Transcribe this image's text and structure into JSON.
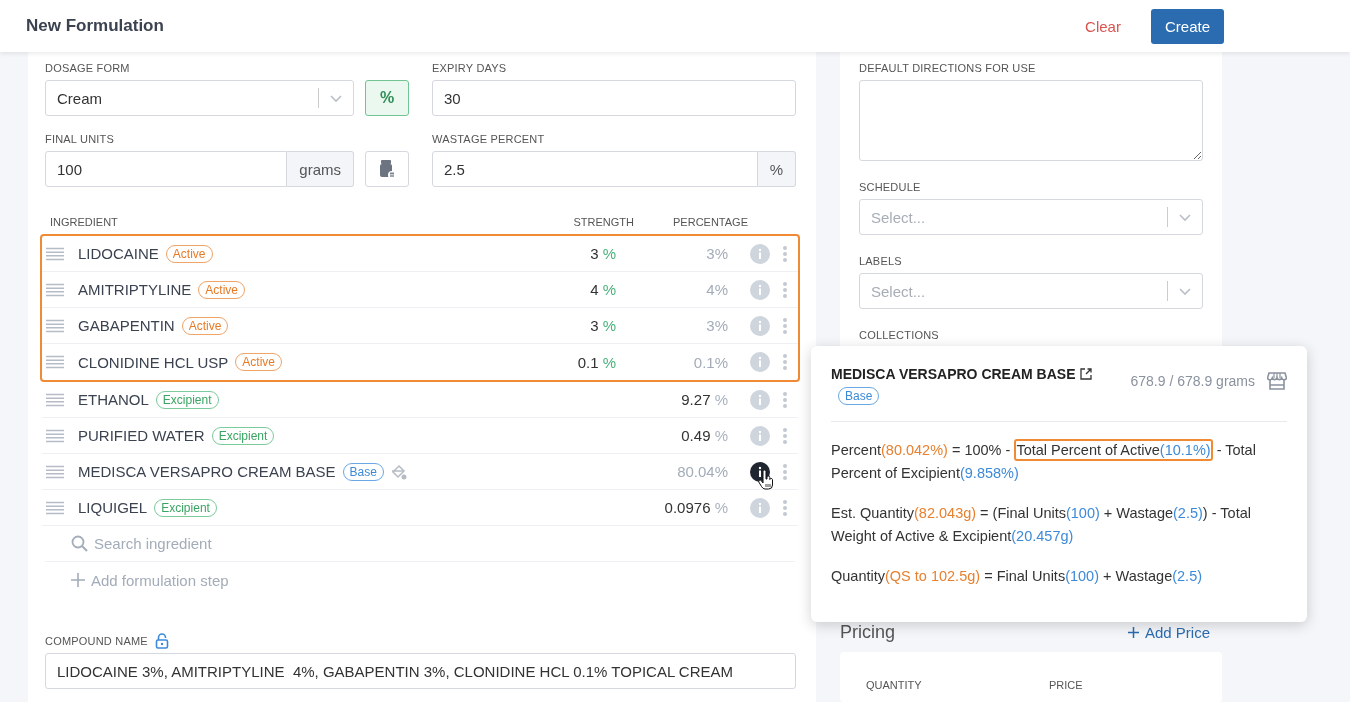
{
  "header": {
    "title": "New Formulation",
    "actions": [
      {
        "label": "Clear",
        "kind": "text"
      },
      {
        "label": "Create",
        "kind": "primary"
      }
    ]
  },
  "form": {
    "dosage_form": {
      "label": "DOSAGE FORM",
      "value": "Cream",
      "toggle": {
        "label": "%",
        "on": true
      }
    },
    "expiry_days": {
      "label": "EXPIRY DAYS",
      "value": "30"
    },
    "final_units": {
      "label": "FINAL UNITS",
      "value": "100",
      "unit": "grams"
    },
    "wastage_percent": {
      "label": "WASTAGE PERCENT",
      "value": "2.5",
      "unit": "%"
    }
  },
  "ingredients": {
    "columns": [
      "INGREDIENT",
      "STRENGTH",
      "PERCENTAGE"
    ],
    "groups": [
      {
        "highlighted": true,
        "rows": [
          {
            "name": "LIDOCAINE",
            "kind": "active",
            "badge": "Active",
            "strength": {
              "value": "3",
              "unit": "%"
            },
            "percentage": "3%",
            "info_hovered": false
          },
          {
            "name": "AMITRIPTYLINE",
            "kind": "active",
            "badge": "Active",
            "strength": {
              "value": "4",
              "unit": "%"
            },
            "percentage": "4%",
            "info_hovered": false
          },
          {
            "name": "GABAPENTIN",
            "kind": "active",
            "badge": "Active",
            "strength": {
              "value": "3",
              "unit": "%"
            },
            "percentage": "3%",
            "info_hovered": false
          },
          {
            "name": "CLONIDINE HCL USP",
            "kind": "active",
            "badge": "Active",
            "strength": {
              "value": "0.1",
              "unit": "%"
            },
            "percentage": "0.1%",
            "info_hovered": false
          }
        ]
      },
      {
        "highlighted": false,
        "rows": [
          {
            "name": "ETHANOL",
            "kind": "excipient",
            "badge": "Excipient",
            "percentage": "9.27",
            "percentage_unit": "%",
            "info_hovered": false
          },
          {
            "name": "PURIFIED WATER",
            "kind": "excipient",
            "badge": "Excipient",
            "percentage": "0.49",
            "percentage_unit": "%",
            "info_hovered": false
          },
          {
            "name": "MEDISCA VERSAPRO CREAM BASE",
            "kind": "base",
            "badge": "Base",
            "qs_icon": true,
            "percentage": "80.04%",
            "info_hovered": true
          },
          {
            "name": "LIQUIGEL",
            "kind": "excipient",
            "badge": "Excipient",
            "percentage": "0.0976",
            "percentage_unit": "%",
            "info_hovered": false
          }
        ]
      }
    ],
    "search": {
      "placeholder": "Search ingredient"
    },
    "add_step": "Add formulation step"
  },
  "compound_name": {
    "label": "COMPOUND NAME",
    "locked": false,
    "value": "LIDOCAINE 3%, AMITRIPTYLINE  4%, GABAPENTIN 3%, CLONIDINE HCL 0.1% TOPICAL CREAM"
  },
  "side": {
    "directions": {
      "label": "DEFAULT DIRECTIONS FOR USE"
    },
    "schedule": {
      "label": "SCHEDULE",
      "placeholder": "Select..."
    },
    "labels": {
      "label": "LABELS",
      "placeholder": "Select..."
    },
    "collections": {
      "label": "COLLECTIONS"
    }
  },
  "pricing": {
    "title": "Pricing",
    "add_label": "Add Price",
    "columns": [
      "QUANTITY",
      "PRICE"
    ]
  },
  "popover": {
    "title": "MEDISCA VERSAPRO CREAM BASE",
    "badge": "Base",
    "kind": "base",
    "stock": "678.9 / 678.9 grams",
    "formulas": [
      [
        {
          "text": "Percent",
          "kind": "plain"
        },
        {
          "text": "(80.042%)",
          "kind": "result"
        },
        {
          "text": " = 100% - ",
          "kind": "plain"
        },
        {
          "kind": "frame",
          "segments": [
            {
              "text": "Total Percent of Active",
              "kind": "plain"
            },
            {
              "text": "(10.1%)",
              "kind": "value"
            }
          ]
        },
        {
          "text": " - Total Percent of Excipient",
          "kind": "plain"
        },
        {
          "text": "(9.858%)",
          "kind": "value"
        }
      ],
      [
        {
          "text": "Est. Quantity",
          "kind": "plain"
        },
        {
          "text": "(82.043g)",
          "kind": "result"
        },
        {
          "text": " = (Final Units",
          "kind": "plain"
        },
        {
          "text": "(100)",
          "kind": "value"
        },
        {
          "text": " + Wastage",
          "kind": "plain"
        },
        {
          "text": "(2.5)",
          "kind": "value"
        },
        {
          "text": ") - Total Weight of Active & Excipient",
          "kind": "plain"
        },
        {
          "text": "(20.457g)",
          "kind": "value"
        }
      ],
      [
        {
          "text": "Quantity",
          "kind": "plain"
        },
        {
          "text": "(QS to 102.5g)",
          "kind": "result"
        },
        {
          "text": " = Final Units",
          "kind": "plain"
        },
        {
          "text": "(100)",
          "kind": "value"
        },
        {
          "text": " + Wastage",
          "kind": "plain"
        },
        {
          "text": "(2.5)",
          "kind": "value"
        }
      ]
    ]
  }
}
